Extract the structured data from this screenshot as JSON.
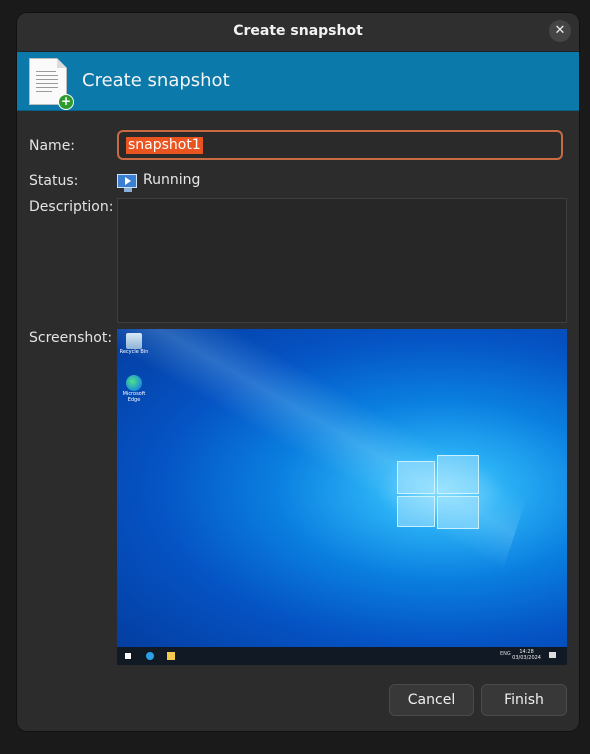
{
  "window": {
    "title": "Create snapshot",
    "close_glyph": "✕"
  },
  "banner": {
    "heading": "Create snapshot",
    "icon": "snapshot-document-add-icon"
  },
  "form": {
    "name_label": "Name:",
    "name_value": "snapshot1",
    "status_label": "Status:",
    "status_value": "Running",
    "status_icon": "running-monitor-icon",
    "description_label": "Description:",
    "description_value": "",
    "screenshot_label": "Screenshot:"
  },
  "screenshot": {
    "desktop_icons": [
      {
        "label": "Recycle Bin",
        "icon": "recycle-bin-icon"
      },
      {
        "label": "Microsoft Edge",
        "icon": "edge-icon"
      }
    ],
    "tray_text": "ENG",
    "clock_time": "14:28",
    "clock_date": "03/03/2024"
  },
  "buttons": {
    "cancel": "Cancel",
    "finish": "Finish"
  },
  "colors": {
    "banner": "#0b79a9",
    "accent_selection": "#e95420",
    "input_focus_border": "#c96b42"
  }
}
